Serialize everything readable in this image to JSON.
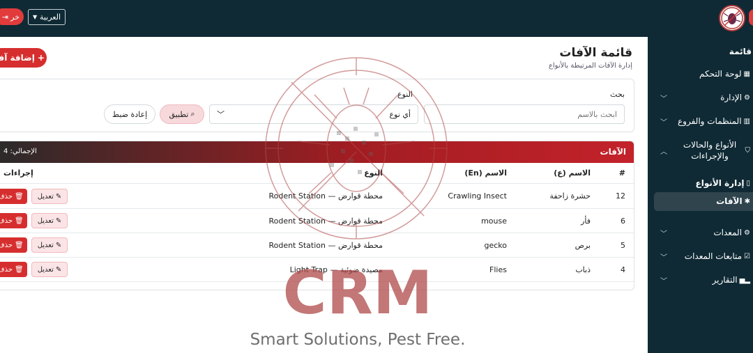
{
  "topbar": {
    "logout_label": "خر",
    "language": "العربية"
  },
  "sidebar": {
    "heading": "قائمة",
    "items": [
      {
        "label": "لوحة التحكم",
        "icon": "dashboard-icon",
        "has_chevron": false
      },
      {
        "label": "الإدارة",
        "icon": "gear-icon",
        "has_chevron": true
      },
      {
        "label": "المنظمات والفروع",
        "icon": "building-icon",
        "has_chevron": true
      },
      {
        "label": "الأنواع والحالات والإجراءات",
        "icon": "shield-icon",
        "has_chevron": true,
        "expanded": true
      },
      {
        "label": "إدارة الأنواع",
        "icon": "book-icon",
        "has_chevron": false,
        "sub": true
      },
      {
        "label": "الآفات",
        "icon": "bug-icon",
        "has_chevron": false,
        "sub": true,
        "active": true
      },
      {
        "label": "المعدات",
        "icon": "gear-icon",
        "has_chevron": true
      },
      {
        "label": "متابعات المعدات",
        "icon": "checklist-icon",
        "has_chevron": true
      },
      {
        "label": "التقارير",
        "icon": "chart-icon",
        "has_chevron": true
      }
    ]
  },
  "page": {
    "title": "قائمة الآفات",
    "subtitle": "إدارة الآفات المرتبطة بالأنواع",
    "add_button": "إضافة آفة"
  },
  "filters": {
    "search_label": "بحث",
    "search_placeholder": "ابحث بالاسم",
    "type_label": "النوع",
    "type_value": "أي نوع",
    "apply_button": "تطبيق",
    "reset_button": "إعادة ضبط"
  },
  "table": {
    "title": "الآفات",
    "total_label": "الإجمالي: 4",
    "headers": {
      "num": "#",
      "name_ar": "الاسم (ع)",
      "name_en": "الاسم (En)",
      "type": "النوع",
      "actions": "إجراءات"
    },
    "rows": [
      {
        "num": "12",
        "name_ar": "حشرة زاحفة",
        "name_en": "Crawling Insect",
        "type": "محطة قوارض — Rodent Station"
      },
      {
        "num": "6",
        "name_ar": "فأر",
        "name_en": "mouse",
        "type": "محطة قوارض — Rodent Station"
      },
      {
        "num": "5",
        "name_ar": "برص",
        "name_en": "gecko",
        "type": "محطة قوارض — Rodent Station"
      },
      {
        "num": "4",
        "name_ar": "ذباب",
        "name_en": "Flies",
        "type": "مصيدة ضوئية — Light Trap"
      }
    ],
    "edit_label": "تعديل",
    "delete_label": "حذف"
  },
  "watermark": {
    "brand": "CRM",
    "tagline": "Smart Solutions, Pest Free."
  },
  "colors": {
    "topbar": "#0f2a35",
    "accent_red": "#d62e2e",
    "watermark_red": "#b04a4a"
  }
}
